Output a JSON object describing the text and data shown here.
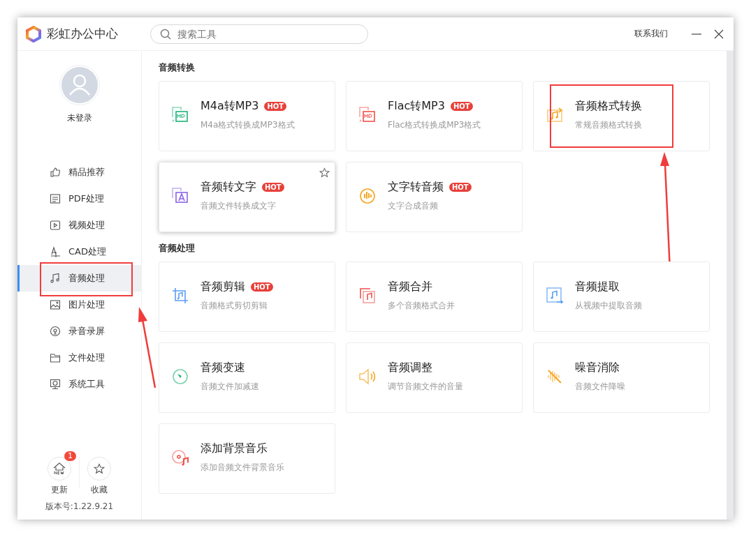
{
  "app": {
    "title": "彩虹办公中心"
  },
  "search": {
    "placeholder": "搜索工具"
  },
  "contact": "联系我们",
  "user": {
    "name": "未登录"
  },
  "nav": [
    {
      "label": "精品推荐",
      "selected": false,
      "annotated": false
    },
    {
      "label": "PDF处理",
      "selected": false,
      "annotated": false
    },
    {
      "label": "视频处理",
      "selected": false,
      "annotated": false
    },
    {
      "label": "CAD处理",
      "selected": false,
      "annotated": false
    },
    {
      "label": "音频处理",
      "selected": true,
      "annotated": true
    },
    {
      "label": "图片处理",
      "selected": false,
      "annotated": false
    },
    {
      "label": "录音录屏",
      "selected": false,
      "annotated": false
    },
    {
      "label": "文件处理",
      "selected": false,
      "annotated": false
    },
    {
      "label": "系统工具",
      "selected": false,
      "annotated": false
    }
  ],
  "footer": {
    "buttons": [
      {
        "label": "更新",
        "badge": "1"
      },
      {
        "label": "收藏"
      }
    ],
    "version": "版本号:1.22.9.21"
  },
  "sections": [
    {
      "title": "音频转换",
      "cards": [
        {
          "title": "M4a转MP3",
          "badge": "HOT",
          "subtitle": "M4a格式转换成MP3格式",
          "hovered": false,
          "annotated": false
        },
        {
          "title": "Flac转MP3",
          "badge": "HOT",
          "subtitle": "Flac格式转换成MP3格式",
          "hovered": false,
          "annotated": false
        },
        {
          "title": "音频格式转换",
          "subtitle": "常规音频格式转换",
          "hovered": false,
          "annotated": true
        },
        {
          "title": "音频转文字",
          "badge": "HOT",
          "subtitle": "音频文件转换成文字",
          "hovered": true,
          "annotated": false
        },
        {
          "title": "文字转音频",
          "badge": "HOT",
          "subtitle": "文字合成音频",
          "hovered": false,
          "annotated": false
        }
      ]
    },
    {
      "title": "音频处理",
      "cards": [
        {
          "title": "音频剪辑",
          "badge": "HOT",
          "subtitle": "音频格式剪切剪辑",
          "hovered": false,
          "annotated": false
        },
        {
          "title": "音频合并",
          "subtitle": "多个音频格式合并",
          "hovered": false,
          "annotated": false
        },
        {
          "title": "音频提取",
          "subtitle": "从视频中提取音频",
          "hovered": false,
          "annotated": false
        },
        {
          "title": "音频变速",
          "subtitle": "音频文件加减速",
          "hovered": false,
          "annotated": false
        },
        {
          "title": "音频调整",
          "subtitle": "调节音频文件的音量",
          "hovered": false,
          "annotated": false
        },
        {
          "title": "噪音消除",
          "subtitle": "音频文件降噪",
          "hovered": false,
          "annotated": false
        },
        {
          "title": "添加背景音乐",
          "subtitle": "添加音频文件背景音乐",
          "hovered": false,
          "annotated": false
        }
      ]
    }
  ]
}
